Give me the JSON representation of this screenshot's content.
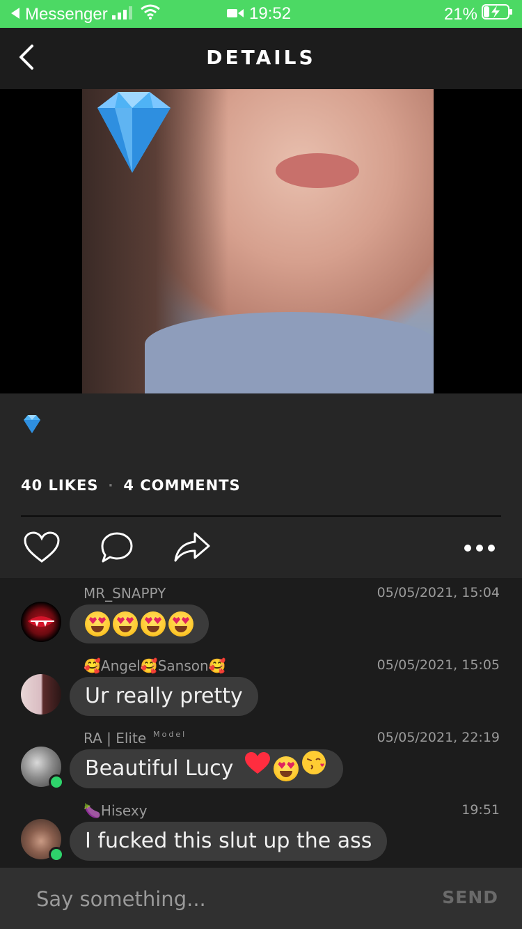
{
  "status_bar": {
    "back_app": "Messenger",
    "time": "19:52",
    "battery": "21%"
  },
  "nav": {
    "title": "DETAILS"
  },
  "post": {
    "caption_emoji": "diamond-emoji",
    "likes": "40 LIKES",
    "separator": "·",
    "comments_count": "4 COMMENTS"
  },
  "comments": [
    {
      "author": "MR_SNAPPY",
      "time": "05/05/2021, 15:04",
      "text": "",
      "emojis": [
        "heart-eyes",
        "heart-eyes",
        "heart-eyes",
        "heart-eyes"
      ],
      "online": false
    },
    {
      "author": "🥰Angel🥰Sanson🥰",
      "time": "05/05/2021, 15:05",
      "text": "Ur really pretty",
      "online": false
    },
    {
      "author": "RA | Elite",
      "author_sup": "Model",
      "time": "05/05/2021, 22:19",
      "text": "Beautiful Lucy",
      "emojis": [
        "red-heart",
        "heart-eyes",
        "kissing-face"
      ],
      "online": true
    },
    {
      "author": "🍆Hisexy",
      "time": "19:51",
      "text": "I fucked this slut up the ass",
      "online": true
    }
  ],
  "input": {
    "placeholder": "Say something...",
    "send_label": "SEND"
  },
  "colors": {
    "status_green": "#4cd964",
    "background": "#262626",
    "comments_bg": "#1c1c1c",
    "bubble": "#3b3b3b",
    "online": "#2ed36b"
  }
}
